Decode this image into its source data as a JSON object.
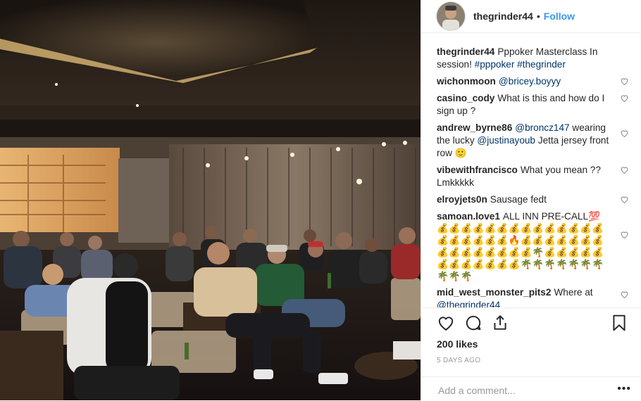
{
  "post": {
    "username": "thegrinder44",
    "separator": "•",
    "follow_label": "Follow",
    "caption_text": "Pppoker Masterclass In session! ",
    "caption_tags": [
      "#pppoker",
      "#thegrinder"
    ]
  },
  "comments": [
    {
      "user": "wichonmoon",
      "mention": "@bricey.boyyy",
      "text": ""
    },
    {
      "user": "casino_cody",
      "mention": "",
      "text": "What is this and how do I sign up ?"
    },
    {
      "user": "andrew_byrne86",
      "mention": "@broncz147",
      "text": " wearing the lucky ",
      "mention2": "@justinayoub",
      "text2": " Jetta jersey front row 🙂"
    },
    {
      "user": "vibewithfrancisco",
      "mention": "",
      "text": "What you mean ?? Lmkkkkk"
    },
    {
      "user": "elroyjets0n",
      "mention": "",
      "text": "Sausage fedt"
    },
    {
      "user": "samoan.love1",
      "mention": "",
      "text": "ALL INN PRE-CALL💯💰💰💰💰💰💰💰💰💰💰💰💰💰💰💰💰💰💰💰💰🔥💰💰💰💰💰💰💰💰💰💰💰💰💰💰💰🌴💰💰💰💰💰💰💰💰💰💰💰💰🌴🌴🌴🌴🌴🌴🌴🌴🌴🌴"
    },
    {
      "user": "mid_west_monster_pits2",
      "mention": "",
      "text": "Where at ",
      "mention2": "@thegrinder44",
      "text2": ""
    }
  ],
  "actions": {
    "like_icon": "heart-outline-icon",
    "comment_icon": "comment-bubble-icon",
    "share_icon": "share-icon",
    "save_icon": "bookmark-icon"
  },
  "likes_text": "200 likes",
  "age_text": "5 DAYS AGO",
  "add_comment_placeholder": "Add a comment...",
  "more_label": "•••",
  "colors": {
    "link": "#003569",
    "follow": "#3897f0",
    "muted": "#999999",
    "text": "#262626"
  }
}
